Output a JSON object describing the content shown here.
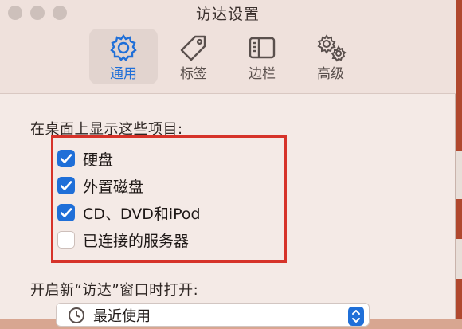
{
  "window": {
    "title": "访达设置"
  },
  "tabs": [
    {
      "label": "通用",
      "icon": "gear-icon",
      "selected": true
    },
    {
      "label": "标签",
      "icon": "tag-icon",
      "selected": false
    },
    {
      "label": "边栏",
      "icon": "sidebar-icon",
      "selected": false
    },
    {
      "label": "高级",
      "icon": "gears-icon",
      "selected": false
    }
  ],
  "desktop_section": {
    "label": "在桌面上显示这些项目:",
    "items": [
      {
        "label": "硬盘",
        "checked": true
      },
      {
        "label": "外置磁盘",
        "checked": true
      },
      {
        "label": "CD、DVD和iPod",
        "checked": true
      },
      {
        "label": "已连接的服务器",
        "checked": false
      }
    ]
  },
  "new_window_section": {
    "label": "开启新“访达”窗口时打开:",
    "selected_value": "最近使用"
  },
  "colors": {
    "accent": "#1f6fd8",
    "highlight_box": "#d6332a"
  }
}
